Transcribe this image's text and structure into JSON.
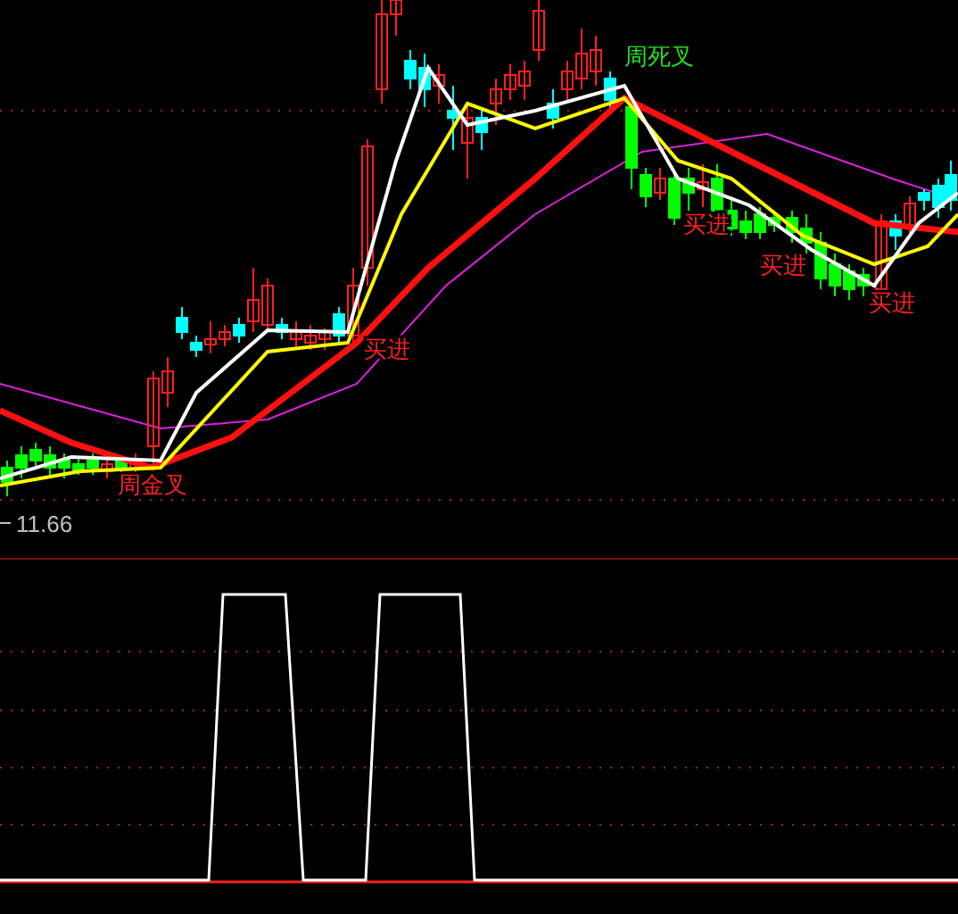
{
  "price_label": "11.66",
  "signals": [
    {
      "text": "周金叉",
      "kind": "golden-cross"
    },
    {
      "text": "买进",
      "kind": "buy"
    },
    {
      "text": "周死叉",
      "kind": "death-cross"
    },
    {
      "text": "买进",
      "kind": "buy"
    },
    {
      "text": "买进",
      "kind": "buy"
    },
    {
      "text": "买进",
      "kind": "buy"
    }
  ]
}
